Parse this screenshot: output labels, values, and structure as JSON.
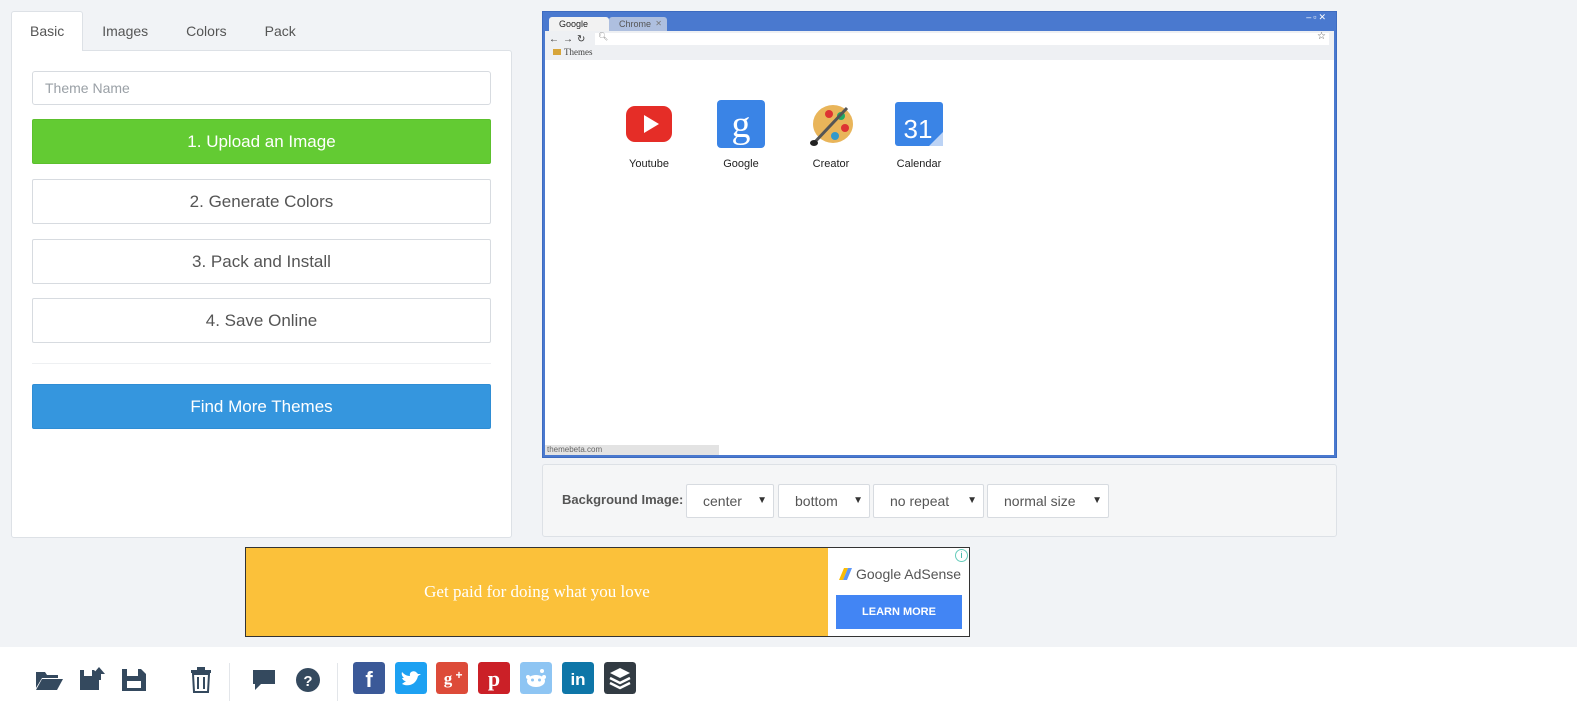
{
  "tabs": [
    "Basic",
    "Images",
    "Colors",
    "Pack"
  ],
  "theme_name_placeholder": "Theme Name",
  "steps": {
    "upload": "1. Upload an Image",
    "generate": "2. Generate Colors",
    "pack": "3. Pack and Install",
    "save": "4. Save Online"
  },
  "find_more": "Find More Themes",
  "preview": {
    "tab_active": "Google",
    "tab_inactive": "Chrome",
    "bookmark": "Themes",
    "apps": [
      "Youtube",
      "Google",
      "Creator",
      "Calendar"
    ],
    "status": "themebeta.com"
  },
  "background": {
    "label": "Background Image:",
    "position_x": "center",
    "position_y": "bottom",
    "repeat": "no repeat",
    "size": "normal size"
  },
  "ad": {
    "headline": "Get paid for doing what you love",
    "brand": "Google AdSense",
    "cta": "LEARN MORE"
  },
  "colors": {
    "green": "#63cb33",
    "blue": "#3596de",
    "facebook": "#3b5998",
    "twitter": "#1da1f2",
    "googleplus": "#dd4b39",
    "pinterest": "#cb2027",
    "reddit": "#8ec5f3",
    "linkedin": "#0e76a8",
    "buffer": "#323b43"
  },
  "icons": [
    "folder-open-icon",
    "save-upload-icon",
    "save-icon",
    "trash-icon",
    "comment-icon",
    "help-icon",
    "facebook-icon",
    "twitter-icon",
    "google-plus-icon",
    "pinterest-icon",
    "reddit-icon",
    "linkedin-icon",
    "buffer-icon"
  ]
}
